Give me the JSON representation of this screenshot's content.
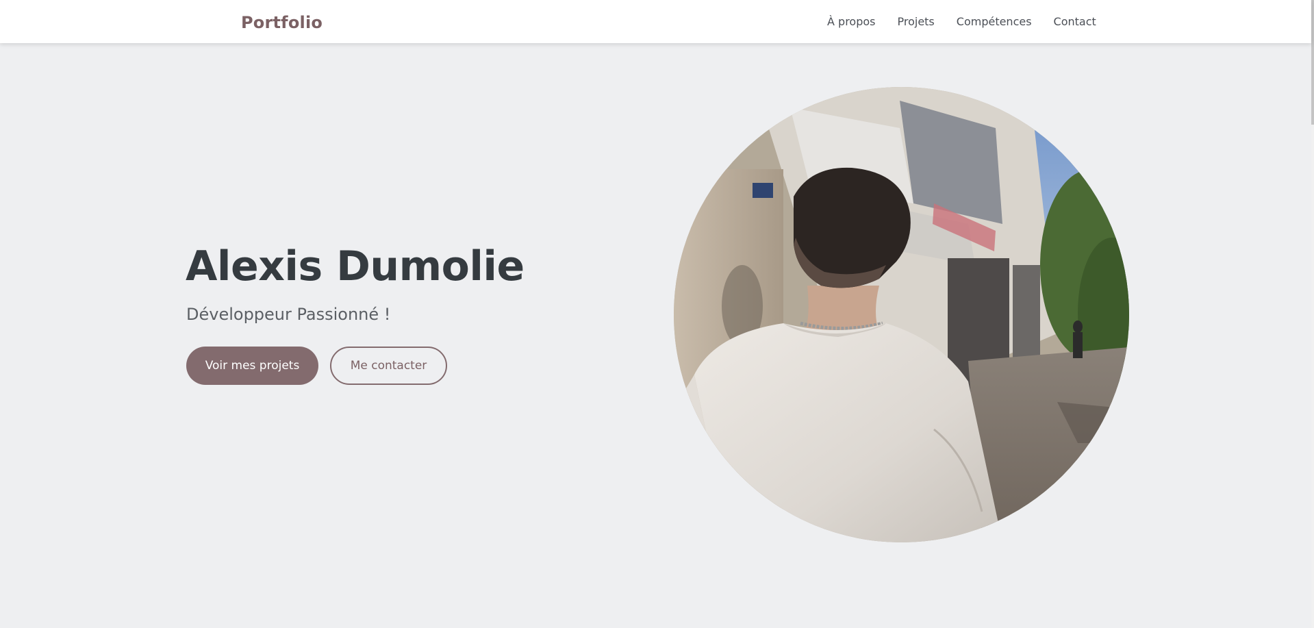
{
  "navbar": {
    "brand": "Portfolio",
    "links": [
      "À propos",
      "Projets",
      "Compétences",
      "Contact"
    ]
  },
  "hero": {
    "name": "Alexis Dumolie",
    "subtitle": "Développeur Passionné !",
    "primary_button": "Voir mes projets",
    "secondary_button": "Me contacter"
  },
  "colors": {
    "accent": "#836b6e",
    "background": "#eeeff1",
    "heading": "#353b40"
  }
}
